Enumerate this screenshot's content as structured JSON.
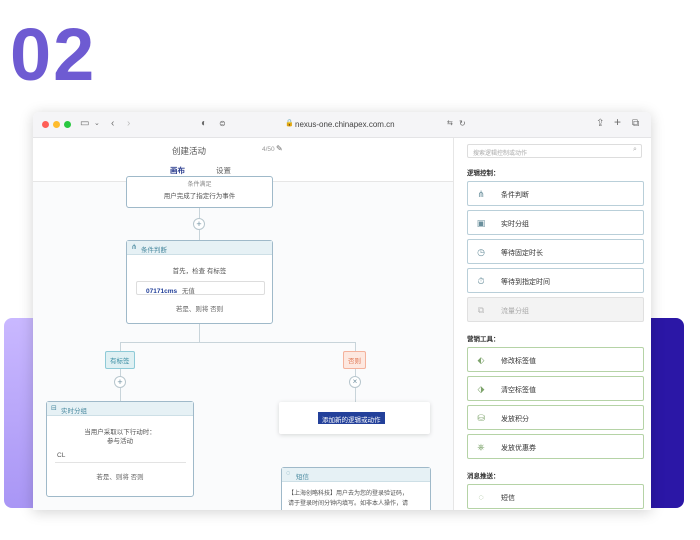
{
  "page": {
    "big_number": "02"
  },
  "browser": {
    "url": "nexus-one.chinapex.com.cn"
  },
  "editor": {
    "title": "创建活动",
    "counter": "4/50",
    "tabs": [
      "画布",
      "设置"
    ]
  },
  "canvas": {
    "top_node": {
      "line1": "条件满足",
      "line2": "用户完成了指定行为事件"
    },
    "condition_node": {
      "title": "条件判断",
      "text": "首先，检查 有标签",
      "field_value": "07171cms",
      "field_suffix": "无值",
      "branches": "若是、则将 否则"
    },
    "branch_yes": "有标签",
    "branch_no": "否则",
    "split_node": {
      "title": "实时分组",
      "text1": "当用户采取以下行动时：",
      "text2": "参与活动",
      "value": "CL",
      "footer": "若是、则将 否则"
    },
    "add_logic_button": "添加新的逻辑或动作",
    "sms_node": {
      "title": "短信",
      "text1": "【上海创略科技】用户去为您的登录验证码，",
      "text2": "请于登录时间分钟内填写。如非本人操作，请"
    }
  },
  "panel": {
    "search_placeholder": "搜索逻辑控制或动作",
    "logic_title": "逻辑控制：",
    "logic_items": [
      "条件判断",
      "实时分组",
      "等待固定时长",
      "等待到指定时间",
      "流量分组"
    ],
    "marketing_title": "营销工具：",
    "marketing_items": [
      "修改标签值",
      "清空标签值",
      "发放积分",
      "发放优惠券"
    ],
    "messaging_title": "消息推送：",
    "messaging_items": [
      "短信"
    ]
  },
  "colors": {
    "brand_purple": "#6e5bd2",
    "deep_blue": "#2b17a6",
    "teal": "#4a8aa0",
    "button_blue": "#23409a"
  }
}
